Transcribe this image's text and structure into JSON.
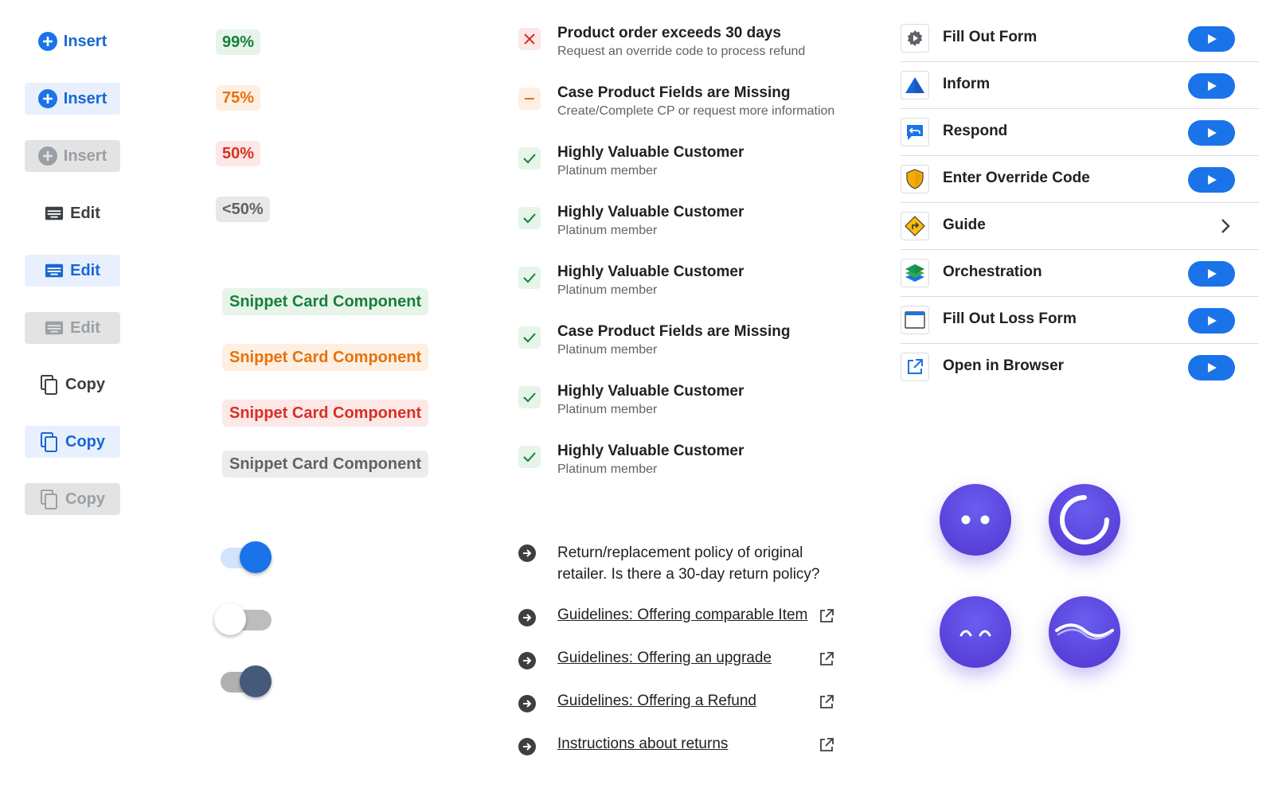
{
  "buttons": [
    {
      "label": "Insert",
      "icon": "plus-circle-icon",
      "style": "plain"
    },
    {
      "label": "Insert",
      "icon": "plus-circle-icon",
      "style": "active"
    },
    {
      "label": "Insert",
      "icon": "plus-circle-icon",
      "style": "disabled"
    },
    {
      "label": "Edit",
      "icon": "keyboard-icon",
      "style": "plain-dark"
    },
    {
      "label": "Edit",
      "icon": "keyboard-icon",
      "style": "active"
    },
    {
      "label": "Edit",
      "icon": "keyboard-icon",
      "style": "disabled"
    },
    {
      "label": "Copy",
      "icon": "copy-icon",
      "style": "plain-dark"
    },
    {
      "label": "Copy",
      "icon": "copy-icon",
      "style": "active"
    },
    {
      "label": "Copy",
      "icon": "copy-icon",
      "style": "disabled"
    }
  ],
  "percentages": [
    {
      "label": "99%",
      "color": "green"
    },
    {
      "label": "75%",
      "color": "orange"
    },
    {
      "label": "50%",
      "color": "red"
    },
    {
      "label": "<50%",
      "color": "grey"
    }
  ],
  "snippets": [
    {
      "label": "Snippet Card Component",
      "color": "green"
    },
    {
      "label": "Snippet Card Component",
      "color": "orange"
    },
    {
      "label": "Snippet Card Component",
      "color": "red"
    },
    {
      "label": "Snippet Card Component",
      "color": "grey"
    }
  ],
  "toggles": [
    {
      "state": "on",
      "color": "#1a73e8"
    },
    {
      "state": "off",
      "color": "#ffffff"
    },
    {
      "state": "on",
      "color": "#455a7a"
    }
  ],
  "statuses": [
    {
      "icon": "close-icon",
      "tone": "red",
      "title": "Product order exceeds 30 days",
      "subtitle": "Request an override code to process refund"
    },
    {
      "icon": "minus-icon",
      "tone": "orange",
      "title": "Case Product Fields are Missing",
      "subtitle": "Create/Complete CP or request more information"
    },
    {
      "icon": "check-icon",
      "tone": "green",
      "title": "Highly Valuable Customer",
      "subtitle": "Platinum member"
    },
    {
      "icon": "check-icon",
      "tone": "green",
      "title": "Highly Valuable Customer",
      "subtitle": "Platinum member"
    },
    {
      "icon": "check-icon",
      "tone": "green",
      "title": "Highly Valuable Customer",
      "subtitle": "Platinum member"
    },
    {
      "icon": "check-icon",
      "tone": "green",
      "title": "Case Product Fields are Missing",
      "subtitle": "Platinum member"
    },
    {
      "icon": "check-icon",
      "tone": "green",
      "title": "Highly Valuable Customer",
      "subtitle": "Platinum member"
    },
    {
      "icon": "check-icon",
      "tone": "green",
      "title": "Highly Valuable Customer",
      "subtitle": "Platinum member"
    }
  ],
  "policy_question": "Return/replacement policy of original retailer. Is there a 30-day return policy?",
  "links": [
    {
      "label": "Guidelines: Offering comparable Item"
    },
    {
      "label": "Guidelines: Offering an upgrade"
    },
    {
      "label": "Guidelines: Offering a Refund"
    },
    {
      "label": "Instructions about returns"
    }
  ],
  "actions": [
    {
      "label": "Fill Out Form",
      "icon": "gear-play-icon",
      "trailing": "play"
    },
    {
      "label": "Inform",
      "icon": "triangle-icon",
      "trailing": "play"
    },
    {
      "label": "Respond",
      "icon": "reply-chat-icon",
      "trailing": "play"
    },
    {
      "label": "Enter Override Code",
      "icon": "shield-icon",
      "trailing": "play"
    },
    {
      "label": "Guide",
      "icon": "turn-sign-icon",
      "trailing": "chevron"
    },
    {
      "label": "Orchestration",
      "icon": "layers-icon",
      "trailing": "play"
    },
    {
      "label": "Fill Out Loss Form",
      "icon": "window-icon",
      "trailing": "play"
    },
    {
      "label": "Open in Browser",
      "icon": "open-external-icon",
      "trailing": "play"
    }
  ],
  "avatars": [
    {
      "state": "idle",
      "icon": "eyes-icon"
    },
    {
      "state": "loading",
      "icon": "spinner-icon"
    },
    {
      "state": "happy",
      "icon": "smile-eyes-icon"
    },
    {
      "state": "speaking",
      "icon": "wave-icon"
    }
  ]
}
